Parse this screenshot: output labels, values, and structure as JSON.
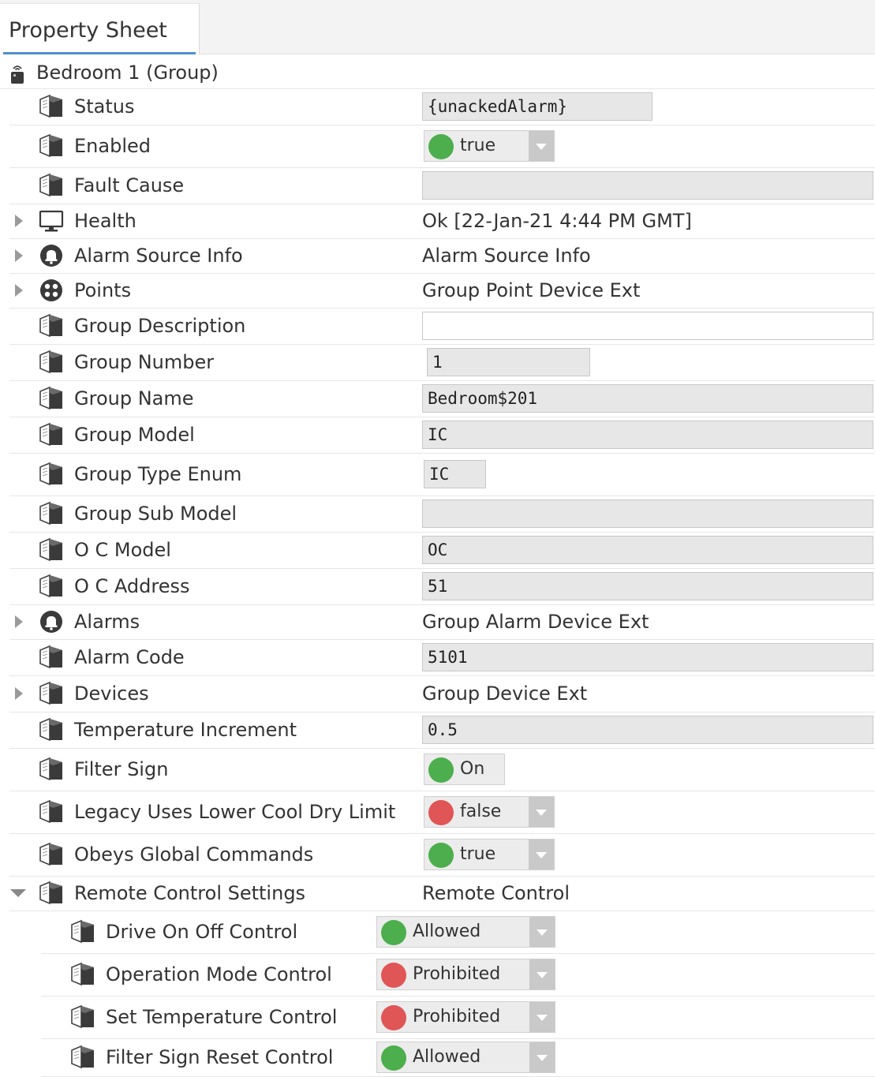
{
  "tab": {
    "label": "Property Sheet"
  },
  "root": {
    "label": "Bedroom 1  (Group)"
  },
  "colors": {
    "green": "#4cae4c",
    "red": "#e05555",
    "accent": "#4f8fcc"
  },
  "rows": [
    {
      "name": "Status",
      "icon": "slot-object-icon",
      "value": "{unackedAlarm}",
      "kind": "field"
    },
    {
      "name": "Enabled",
      "icon": "slot-object-icon",
      "value": "true",
      "kind": "dropdown",
      "status": "green"
    },
    {
      "name": "Fault Cause",
      "icon": "slot-object-icon",
      "value": "",
      "kind": "field"
    },
    {
      "name": "Health",
      "icon": "monitor-icon",
      "value": "Ok [22-Jan-21 4:44 PM GMT]",
      "kind": "text",
      "expandable": true
    },
    {
      "name": "Alarm Source Info",
      "icon": "alarm-bell-icon",
      "value": "Alarm Source Info",
      "kind": "text",
      "expandable": true
    },
    {
      "name": "Points",
      "icon": "points-icon",
      "value": "Group Point Device Ext",
      "kind": "text",
      "expandable": true
    },
    {
      "name": "Group Description",
      "icon": "slot-object-icon",
      "value": "",
      "kind": "field-white"
    },
    {
      "name": "Group Number",
      "icon": "slot-object-icon",
      "value": "1",
      "kind": "field"
    },
    {
      "name": "Group Name",
      "icon": "slot-object-icon",
      "value": "Bedroom$201",
      "kind": "field"
    },
    {
      "name": "Group Model",
      "icon": "slot-object-icon",
      "value": "IC",
      "kind": "field"
    },
    {
      "name": "Group Type Enum",
      "icon": "slot-object-icon",
      "value": "IC",
      "kind": "field"
    },
    {
      "name": "Group Sub Model",
      "icon": "slot-object-icon",
      "value": "",
      "kind": "field"
    },
    {
      "name": "O C Model",
      "icon": "slot-object-icon",
      "value": "OC",
      "kind": "field"
    },
    {
      "name": "O C Address",
      "icon": "slot-object-icon",
      "value": "51",
      "kind": "field"
    },
    {
      "name": "Alarms",
      "icon": "alarm-bell-icon",
      "value": "Group Alarm Device Ext",
      "kind": "text",
      "expandable": true
    },
    {
      "name": "Alarm Code",
      "icon": "slot-object-icon",
      "value": "5101",
      "kind": "field"
    },
    {
      "name": "Devices",
      "icon": "slot-object-icon",
      "value": "Group Device Ext",
      "kind": "text",
      "expandable": true
    },
    {
      "name": "Temperature Increment",
      "icon": "slot-object-icon",
      "value": "0.5",
      "kind": "field"
    },
    {
      "name": "Filter Sign",
      "icon": "slot-object-icon",
      "value": "On",
      "kind": "indicator",
      "status": "green"
    },
    {
      "name": "Legacy Uses Lower Cool Dry Limit",
      "icon": "slot-object-icon",
      "value": "false",
      "kind": "dropdown",
      "status": "red"
    },
    {
      "name": "Obeys Global Commands",
      "icon": "slot-object-icon",
      "value": "true",
      "kind": "dropdown",
      "status": "green"
    },
    {
      "name": "Remote Control Settings",
      "icon": "slot-object-icon",
      "value": "Remote Control",
      "kind": "text",
      "expandable": true,
      "expanded": true
    },
    {
      "name": "Drive On Off Control",
      "icon": "slot-object-icon",
      "value": "Allowed",
      "kind": "dropdown",
      "status": "green",
      "child": true
    },
    {
      "name": "Operation Mode Control",
      "icon": "slot-object-icon",
      "value": "Prohibited",
      "kind": "dropdown",
      "status": "red",
      "child": true
    },
    {
      "name": "Set Temperature Control",
      "icon": "slot-object-icon",
      "value": "Prohibited",
      "kind": "dropdown",
      "status": "red",
      "child": true
    },
    {
      "name": "Filter Sign Reset Control",
      "icon": "slot-object-icon",
      "value": "Allowed",
      "kind": "dropdown",
      "status": "green",
      "child": true
    }
  ]
}
